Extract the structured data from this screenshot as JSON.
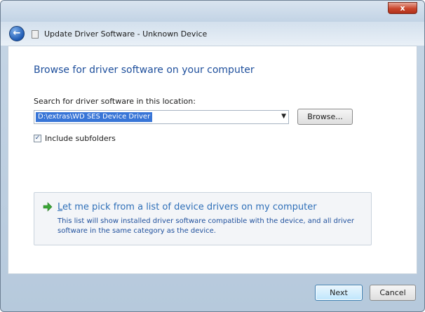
{
  "window": {
    "title": "Update Driver Software - Unknown Device",
    "close_label": "x"
  },
  "nav": {
    "back_glyph": "←"
  },
  "main": {
    "heading": "Browse for driver software on your computer",
    "search_label": "Search for driver software in this location:",
    "path_value": "D:\\extras\\WD SES Device Driver",
    "browse_label": "Browse...",
    "include_subfolders": {
      "label": "Include subfolders",
      "checked": true,
      "check_glyph": "✓"
    },
    "pick_option": {
      "title_first_letter": "L",
      "title_rest": "et me pick from a list of device drivers on my computer",
      "description": "This list will show installed driver software compatible with the device, and all driver software in the same category as the device."
    }
  },
  "footer": {
    "next_label": "Next",
    "cancel_label": "Cancel"
  },
  "colors": {
    "heading": "#1e4f9c",
    "link": "#2e6fb8",
    "selection": "#3875d7",
    "arrow_green": "#3aa535"
  },
  "icons": {
    "back": "back-arrow-icon",
    "document": "document-icon",
    "dropdown": "chevron-down-icon",
    "option_arrow": "green-arrow-icon",
    "check": "checkmark-icon",
    "close": "close-icon"
  }
}
